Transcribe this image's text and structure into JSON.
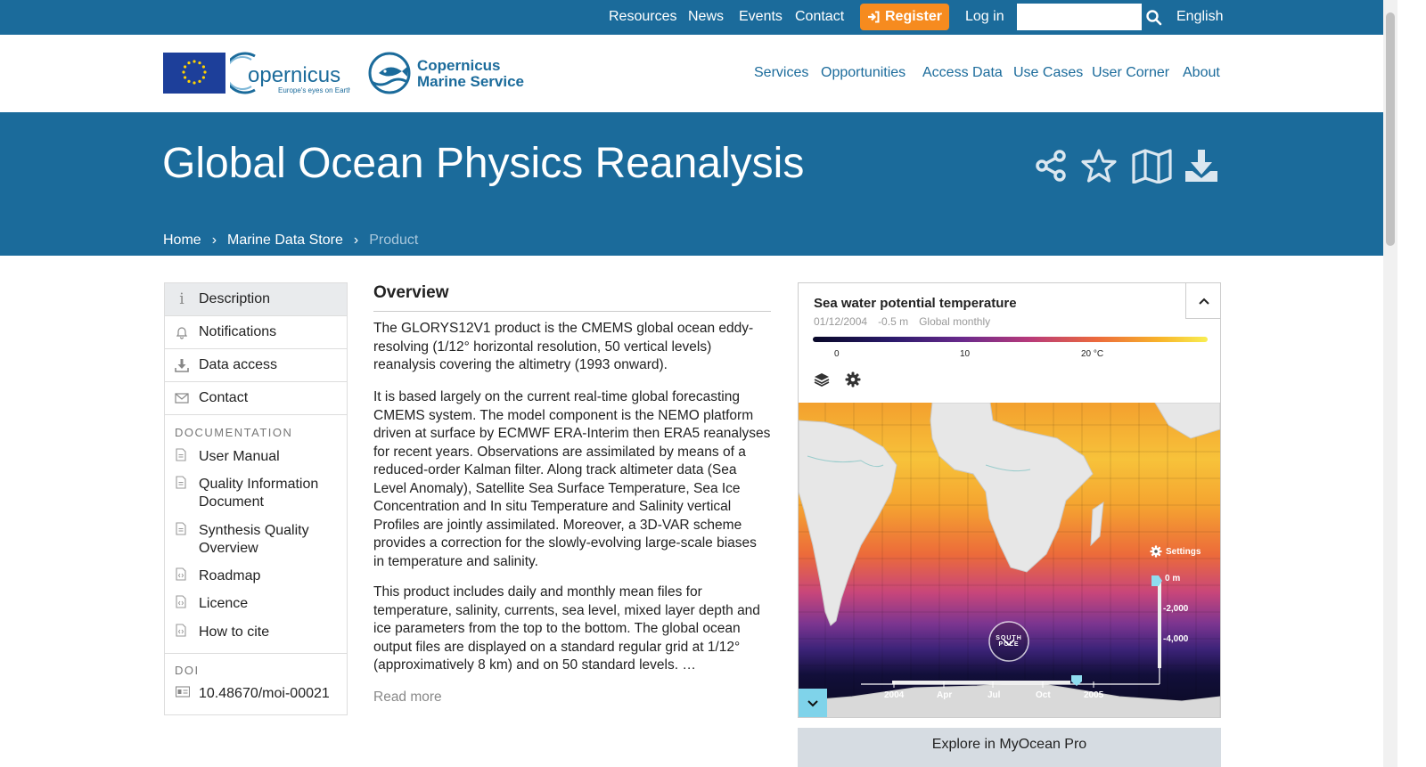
{
  "topbar": {
    "links": [
      "Resources",
      "News",
      "Events",
      "Contact"
    ],
    "register_label": "Register",
    "login_label": "Log in",
    "search_placeholder": "",
    "language": "English",
    "bg_color": "#1b6b9b",
    "register_color": "#f68b1f"
  },
  "header": {
    "copernicus_logo_text": "opernicus",
    "copernicus_tagline": "Europe's eyes on Earth",
    "cms_name_line1": "Copernicus",
    "cms_name_line2": "Marine Service",
    "nav": [
      "Services",
      "Opportunities",
      "Access Data",
      "Use Cases",
      "User Corner",
      "About"
    ]
  },
  "hero": {
    "title": "Global Ocean Physics Reanalysis",
    "actions": [
      "share-icon",
      "star-icon",
      "map-icon",
      "download-icon"
    ],
    "breadcrumb": [
      "Home",
      "Marine Data Store",
      "Product"
    ]
  },
  "sidebar": {
    "items": [
      {
        "label": "Description",
        "icon": "info-icon"
      },
      {
        "label": "Notifications",
        "icon": "bell-icon"
      },
      {
        "label": "Data access",
        "icon": "download-icon"
      },
      {
        "label": "Contact",
        "icon": "envelope-icon"
      }
    ],
    "documentation_heading": "DOCUMENTATION",
    "docs": [
      "User Manual",
      "Quality Information Document",
      "Synthesis Quality Overview",
      "Roadmap",
      "Licence",
      "How to cite"
    ],
    "doi_heading": "DOI",
    "doi": "10.48670/moi-00021"
  },
  "overview": {
    "title": "Overview",
    "paragraphs": [
      "The GLORYS12V1 product is the CMEMS global ocean eddy-resolving (1/12° horizontal resolution, 50 vertical levels) reanalysis covering the altimetry (1993 onward).",
      "It is based largely on the current real-time global forecasting CMEMS system. The model component is the NEMO platform driven at surface by ECMWF ERA-Interim then ERA5 reanalyses for recent years. Observations are assimilated by means of a reduced-order Kalman filter. Along track altimeter data (Sea Level Anomaly), Satellite Sea Surface Temperature, Sea Ice Concentration and In situ Temperature and Salinity vertical Profiles are jointly assimilated. Moreover, a 3D-VAR scheme provides a correction for the slowly-evolving large-scale biases in temperature and salinity.",
      "This product includes daily and monthly mean files for temperature, salinity, currents, sea level, mixed layer depth and ice parameters from the top to the bottom. The global ocean output files are displayed on a standard regular grid at 1/12° (approximatively 8 km) and on 50 standard levels. …"
    ],
    "read_more": "Read more"
  },
  "widget": {
    "title": "Sea water potential temperature",
    "date": "01/12/2004",
    "depth": "-0.5 m",
    "frequency": "Global monthly",
    "scale_ticks": [
      "0",
      "10",
      "20 °C"
    ],
    "map_settings_label": "Settings",
    "depth_ticks": [
      "0 m",
      "-2,000",
      "-4,000"
    ],
    "time_ticks": [
      "2004",
      "Apr",
      "Jul",
      "Oct",
      "2005"
    ],
    "compass_label": "SOUTH POLE",
    "explore_label": "Explore in MyOcean Pro"
  }
}
